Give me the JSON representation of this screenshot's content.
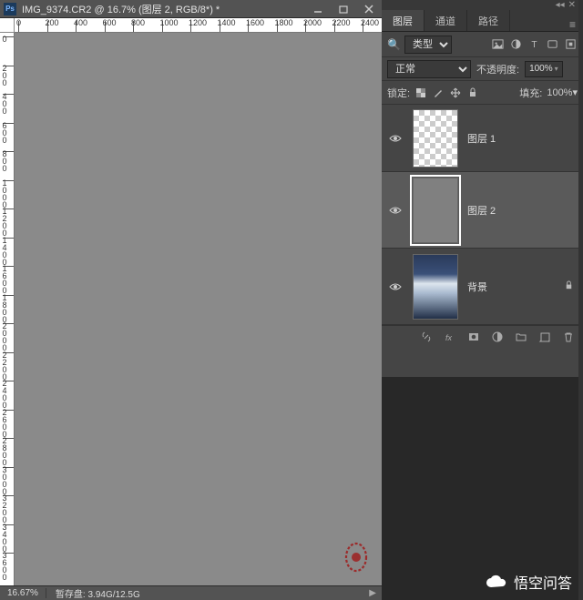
{
  "titlebar": {
    "filename": "IMG_9374.CR2 @ 16.7% (图层 2, RGB/8*) *"
  },
  "ruler_h": [
    "0",
    "200",
    "400",
    "600",
    "800",
    "1000",
    "1200",
    "1400",
    "1600",
    "1800",
    "2000",
    "2200",
    "2400"
  ],
  "ruler_v": [
    "0",
    "200",
    "400",
    "600",
    "800",
    "1000",
    "1200",
    "1400",
    "1600",
    "1800",
    "2000",
    "2200",
    "2400",
    "2600",
    "2800",
    "3000",
    "3200",
    "3400",
    "3600"
  ],
  "status": {
    "zoom": "16.67%",
    "scratch_label": "暂存盘:",
    "scratch_value": "3.94G/12.5G"
  },
  "panel": {
    "tabs": [
      "图层",
      "通道",
      "路径"
    ],
    "filter_kind": "类型",
    "blend_mode": "正常",
    "opacity_label": "不透明度:",
    "opacity_value": "100%",
    "lock_label": "锁定:",
    "fill_label": "填充:",
    "fill_value": "100%"
  },
  "layers": [
    {
      "name": "图层 1",
      "visible": true,
      "thumb": "checker"
    },
    {
      "name": "图层 2",
      "visible": true,
      "thumb": "gray",
      "selected": true
    },
    {
      "name": "背景",
      "visible": true,
      "thumb": "photo",
      "locked": true
    }
  ],
  "brand": "悟空问答"
}
